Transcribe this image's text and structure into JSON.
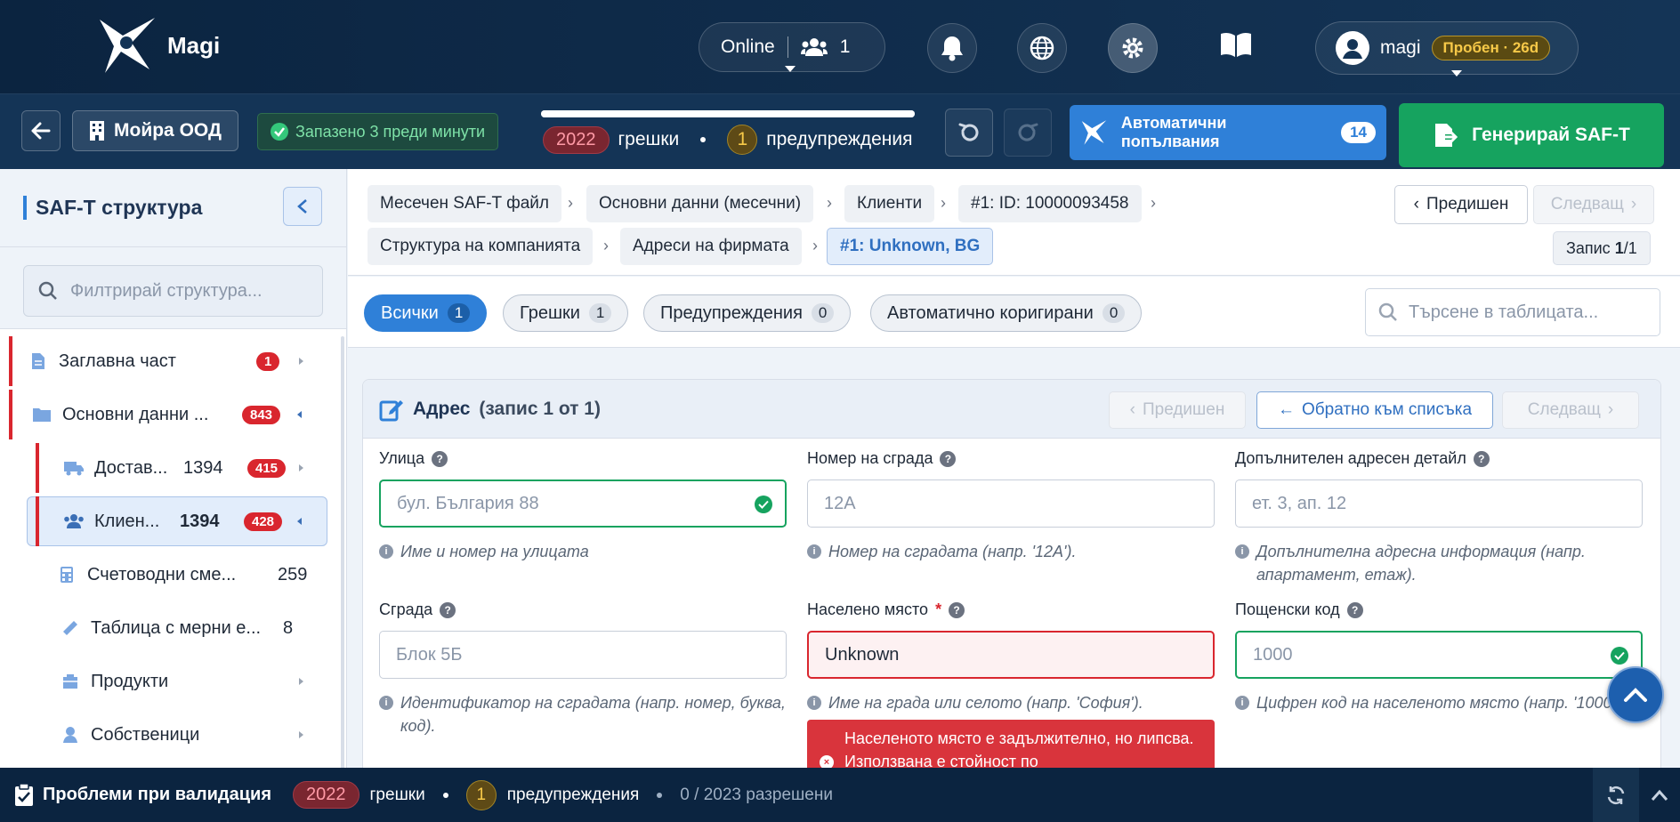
{
  "app": {
    "name": "Magi"
  },
  "topbar": {
    "online_label": "Online",
    "online_count": "1",
    "user_name": "magi",
    "trial_badge": "Пробен · 26d"
  },
  "toolbar": {
    "company": "Мойра ООД",
    "saved_status": "Запазено 3 преди минути",
    "errors_count": "2022",
    "errors_label": "грешки",
    "warnings_count": "1",
    "warnings_label": "предупреждения",
    "progress": 1.0,
    "auto_fill_label": "Автоматични попълвания",
    "auto_fill_count": "14",
    "generate_label": "Генерирай SAF-T"
  },
  "sidebar": {
    "title": "SAF-T структура",
    "filter_placeholder": "Филтрирай структура...",
    "items": [
      {
        "label": "Заглавна част",
        "count": "",
        "badge": "1"
      },
      {
        "label": "Основни данни ...",
        "count": "",
        "badge": "843"
      },
      {
        "label": "Достав...",
        "count": "1394",
        "badge": "415"
      },
      {
        "label": "Клиен...",
        "count": "1394",
        "badge": "428"
      },
      {
        "label": "Счетоводни сме...",
        "count": "259",
        "badge": ""
      },
      {
        "label": "Таблица с мерни е...",
        "count": "8",
        "badge": ""
      },
      {
        "label": "Продукти",
        "count": "",
        "badge": ""
      },
      {
        "label": "Собственици",
        "count": "",
        "badge": ""
      }
    ]
  },
  "breadcrumbs": [
    "Месечен SAF-T файл",
    "Основни данни (месечни)",
    "Клиенти",
    "#1: ID: 10000093458",
    "Структура на компанията",
    "Адреси на фирмата",
    "#1: Unknown, BG"
  ],
  "nav": {
    "prev": "Предишен",
    "next": "Следващ",
    "record_label": "Запис",
    "record_current": "1",
    "record_total": "/1"
  },
  "filters": [
    {
      "label": "Всички",
      "count": "1"
    },
    {
      "label": "Грешки",
      "count": "1"
    },
    {
      "label": "Предупреждения",
      "count": "0"
    },
    {
      "label": "Автоматично коригирани",
      "count": "0"
    }
  ],
  "table_search_placeholder": "Търсене в таблицата...",
  "form": {
    "title": "Адрес",
    "subtitle": "(запис 1 от 1)",
    "prev": "Предишен",
    "back": "Обратно към списъка",
    "next": "Следващ",
    "fields": [
      {
        "label": "Улица",
        "placeholder": "бул. България 88",
        "hint": "Име и номер на улицата"
      },
      {
        "label": "Номер на сграда",
        "placeholder": "12A",
        "hint": "Номер на сградата (напр. '12A')."
      },
      {
        "label": "Допълнителен адресен детайл",
        "placeholder": "ет. 3, ап. 12",
        "hint": "Допълнителна адресна информация (напр. апартамент, етаж)."
      },
      {
        "label": "Сграда",
        "placeholder": "Блок 5Б",
        "hint": "Идентификатор на сградата (напр. номер, буква, код)."
      },
      {
        "label": "Населено място",
        "required": "*",
        "value": "Unknown",
        "hint": "Име на града или селото (напр. 'София').",
        "error": "Населеното място е задължително, но липсва. Използвана е стойност по"
      },
      {
        "label": "Пощенски код",
        "placeholder": "1000",
        "hint": "Цифрен код на населеното място (напр. '1000')."
      }
    ]
  },
  "bottombar": {
    "title": "Проблеми при валидация",
    "errors_count": "2022",
    "errors_label": "грешки",
    "warnings_count": "1",
    "warnings_label": "предупреждения",
    "resolved": "0 / 2023 разрешени"
  },
  "colors": {
    "primary": "#2f80d8",
    "success": "#16a35f",
    "danger": "#d9262e",
    "warning": "#f7c948",
    "navy": "#0b2440"
  }
}
